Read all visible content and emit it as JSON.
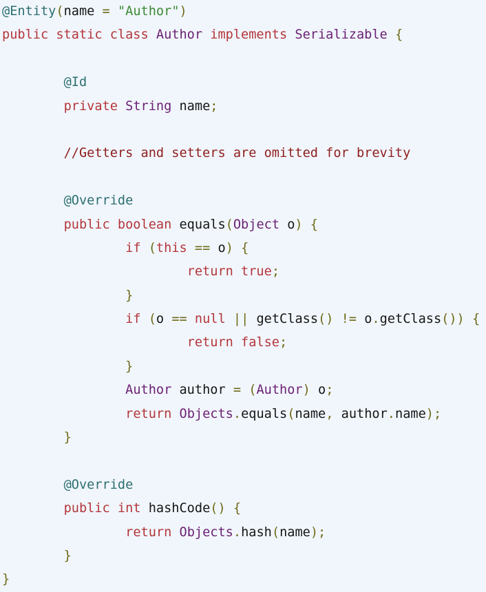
{
  "code": {
    "colors": {
      "keyword": "#b3363a",
      "type": "#6b1f73",
      "annotation": "#2c6f70",
      "string": "#3c8a35",
      "punctuation": "#6e6a18",
      "identifier": "#151515",
      "comment": "#8f1d1d",
      "background": "#f1f6fc"
    },
    "lines": [
      {
        "indent": 0,
        "tokens": [
          [
            "@Entity",
            "ann"
          ],
          [
            "(",
            "punc"
          ],
          [
            "name",
            "id"
          ],
          [
            " = ",
            "punc"
          ],
          [
            "\"Author\"",
            "str"
          ],
          [
            ")",
            "punc"
          ]
        ]
      },
      {
        "indent": 0,
        "tokens": [
          [
            "public static class ",
            "kw"
          ],
          [
            "Author",
            "type"
          ],
          [
            " implements ",
            "kw"
          ],
          [
            "Serializable",
            "type"
          ],
          [
            " {",
            "punc"
          ]
        ]
      },
      {
        "indent": 0,
        "tokens": []
      },
      {
        "indent": 1,
        "tokens": [
          [
            "@Id",
            "ann"
          ]
        ]
      },
      {
        "indent": 1,
        "tokens": [
          [
            "private ",
            "kw"
          ],
          [
            "String",
            "type"
          ],
          [
            " name",
            "id"
          ],
          [
            ";",
            "punc"
          ]
        ]
      },
      {
        "indent": 0,
        "tokens": []
      },
      {
        "indent": 1,
        "tokens": [
          [
            "//Getters and setters are omitted for brevity",
            "cm"
          ]
        ]
      },
      {
        "indent": 0,
        "tokens": []
      },
      {
        "indent": 1,
        "tokens": [
          [
            "@Override",
            "ann"
          ]
        ]
      },
      {
        "indent": 1,
        "tokens": [
          [
            "public boolean ",
            "kw"
          ],
          [
            "equals",
            "id"
          ],
          [
            "(",
            "punc"
          ],
          [
            "Object",
            "type"
          ],
          [
            " o",
            "id"
          ],
          [
            ") {",
            "punc"
          ]
        ]
      },
      {
        "indent": 2,
        "tokens": [
          [
            "if ",
            "kw"
          ],
          [
            "(",
            "punc"
          ],
          [
            "this",
            "kw"
          ],
          [
            " == ",
            "punc"
          ],
          [
            "o",
            "id"
          ],
          [
            ") {",
            "punc"
          ]
        ]
      },
      {
        "indent": 3,
        "tokens": [
          [
            "return true",
            "kw"
          ],
          [
            ";",
            "punc"
          ]
        ]
      },
      {
        "indent": 2,
        "tokens": [
          [
            "}",
            "punc"
          ]
        ]
      },
      {
        "indent": 2,
        "tokens": [
          [
            "if ",
            "kw"
          ],
          [
            "(",
            "punc"
          ],
          [
            "o",
            "id"
          ],
          [
            " == ",
            "punc"
          ],
          [
            "null",
            "kw"
          ],
          [
            " || ",
            "punc"
          ],
          [
            "getClass",
            "id"
          ],
          [
            "() != ",
            "punc"
          ],
          [
            "o",
            "id"
          ],
          [
            ".",
            "punc"
          ],
          [
            "getClass",
            "id"
          ],
          [
            "()) {",
            "punc"
          ]
        ]
      },
      {
        "indent": 3,
        "tokens": [
          [
            "return false",
            "kw"
          ],
          [
            ";",
            "punc"
          ]
        ]
      },
      {
        "indent": 2,
        "tokens": [
          [
            "}",
            "punc"
          ]
        ]
      },
      {
        "indent": 2,
        "tokens": [
          [
            "Author",
            "type"
          ],
          [
            " author",
            "id"
          ],
          [
            " = (",
            "punc"
          ],
          [
            "Author",
            "type"
          ],
          [
            ") ",
            "punc"
          ],
          [
            "o",
            "id"
          ],
          [
            ";",
            "punc"
          ]
        ]
      },
      {
        "indent": 2,
        "tokens": [
          [
            "return ",
            "kw"
          ],
          [
            "Objects",
            "type"
          ],
          [
            ".",
            "punc"
          ],
          [
            "equals",
            "id"
          ],
          [
            "(",
            "punc"
          ],
          [
            "name",
            "id"
          ],
          [
            ", ",
            "punc"
          ],
          [
            "author",
            "id"
          ],
          [
            ".",
            "punc"
          ],
          [
            "name",
            "id"
          ],
          [
            ");",
            "punc"
          ]
        ]
      },
      {
        "indent": 1,
        "tokens": [
          [
            "}",
            "punc"
          ]
        ]
      },
      {
        "indent": 0,
        "tokens": []
      },
      {
        "indent": 1,
        "tokens": [
          [
            "@Override",
            "ann"
          ]
        ]
      },
      {
        "indent": 1,
        "tokens": [
          [
            "public int ",
            "kw"
          ],
          [
            "hashCode",
            "id"
          ],
          [
            "() {",
            "punc"
          ]
        ]
      },
      {
        "indent": 2,
        "tokens": [
          [
            "return ",
            "kw"
          ],
          [
            "Objects",
            "type"
          ],
          [
            ".",
            "punc"
          ],
          [
            "hash",
            "id"
          ],
          [
            "(",
            "punc"
          ],
          [
            "name",
            "id"
          ],
          [
            ");",
            "punc"
          ]
        ]
      },
      {
        "indent": 1,
        "tokens": [
          [
            "}",
            "punc"
          ]
        ]
      },
      {
        "indent": 0,
        "tokens": [
          [
            "}",
            "punc"
          ]
        ]
      }
    ]
  }
}
